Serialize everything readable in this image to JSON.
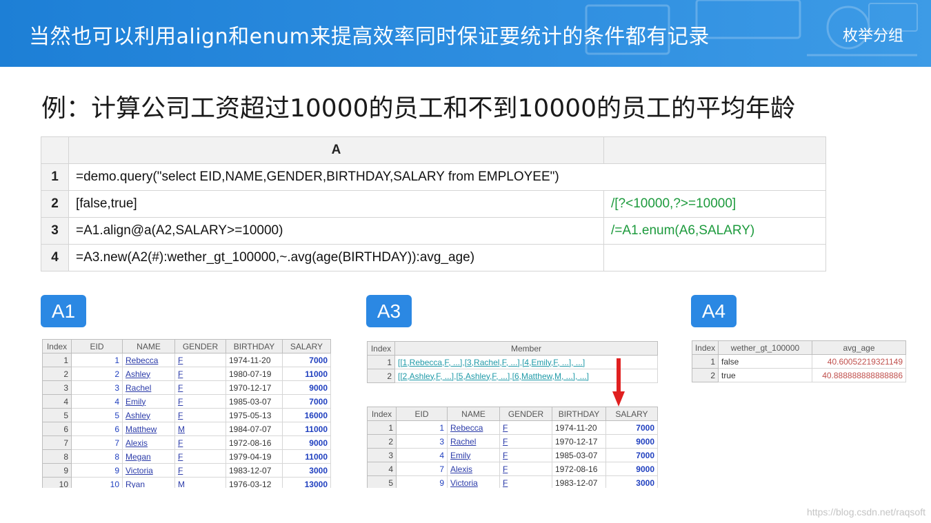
{
  "header": {
    "title": "当然也可以利用align和enum来提高效率同时保证要统计的条件都有记录",
    "brand": "枚举分组",
    "colors": {
      "banner": "#2e8ee0",
      "text": "#ffffff"
    }
  },
  "subtitle": "例：计算公司工资超过10000的员工和不到10000的员工的平均年龄",
  "code_grid": {
    "column_header": "A",
    "rows": [
      {
        "num": "1",
        "a": "=demo.query(\"select  EID,NAME,GENDER,BIRTHDAY,SALARY  from EMPLOYEE\")",
        "b": ""
      },
      {
        "num": "2",
        "a": "[false,true]",
        "b": "/[?<10000,?>=10000]"
      },
      {
        "num": "3",
        "a": "=A1.align@a(A2,SALARY>=10000)",
        "b": "/=A1.enum(A6,SALARY)"
      },
      {
        "num": "4",
        "a": "=A3.new(A2(#):wether_gt_100000,~.avg(age(BIRTHDAY)):avg_age)",
        "b": ""
      }
    ],
    "comment_color": "#1c9a3c"
  },
  "badges": {
    "a1": "A1",
    "a3": "A3",
    "a4": "A4",
    "color": "#2b88e3"
  },
  "table_a1": {
    "columns": [
      "Index",
      "EID",
      "NAME",
      "GENDER",
      "BIRTHDAY",
      "SALARY"
    ],
    "rows": [
      [
        "1",
        "1",
        "Rebecca",
        "F",
        "1974-11-20",
        "7000"
      ],
      [
        "2",
        "2",
        "Ashley",
        "F",
        "1980-07-19",
        "11000"
      ],
      [
        "3",
        "3",
        "Rachel",
        "F",
        "1970-12-17",
        "9000"
      ],
      [
        "4",
        "4",
        "Emily",
        "F",
        "1985-03-07",
        "7000"
      ],
      [
        "5",
        "5",
        "Ashley",
        "F",
        "1975-05-13",
        "16000"
      ],
      [
        "6",
        "6",
        "Matthew",
        "M",
        "1984-07-07",
        "11000"
      ],
      [
        "7",
        "7",
        "Alexis",
        "F",
        "1972-08-16",
        "9000"
      ],
      [
        "8",
        "8",
        "Megan",
        "F",
        "1979-04-19",
        "11000"
      ],
      [
        "9",
        "9",
        "Victoria",
        "F",
        "1983-12-07",
        "3000"
      ],
      [
        "10",
        "10",
        "Ryan",
        "M",
        "1976-03-12",
        "13000"
      ]
    ]
  },
  "table_a3_members": {
    "columns": [
      "Index",
      "Member"
    ],
    "rows": [
      [
        "1",
        "[[1,Rebecca,F, ...],[3,Rachel,F, ...],[4,Emily,F, ...], ...]"
      ],
      [
        "2",
        "[[2,Ashley,F, ...],[5,Ashley,F, ...],[6,Matthew,M, ...], ...]"
      ]
    ]
  },
  "table_a3_detail": {
    "columns": [
      "Index",
      "EID",
      "NAME",
      "GENDER",
      "BIRTHDAY",
      "SALARY"
    ],
    "rows": [
      [
        "1",
        "1",
        "Rebecca",
        "F",
        "1974-11-20",
        "7000"
      ],
      [
        "2",
        "3",
        "Rachel",
        "F",
        "1970-12-17",
        "9000"
      ],
      [
        "3",
        "4",
        "Emily",
        "F",
        "1985-03-07",
        "7000"
      ],
      [
        "4",
        "7",
        "Alexis",
        "F",
        "1972-08-16",
        "9000"
      ],
      [
        "5",
        "9",
        "Victoria",
        "F",
        "1983-12-07",
        "3000"
      ]
    ]
  },
  "table_a4": {
    "columns": [
      "Index",
      "wether_gt_100000",
      "avg_age"
    ],
    "rows": [
      [
        "1",
        "false",
        "40.60052219321149"
      ],
      [
        "2",
        "true",
        "40.888888888888886"
      ]
    ]
  },
  "watermark": "https://blog.csdn.net/raqsoft"
}
